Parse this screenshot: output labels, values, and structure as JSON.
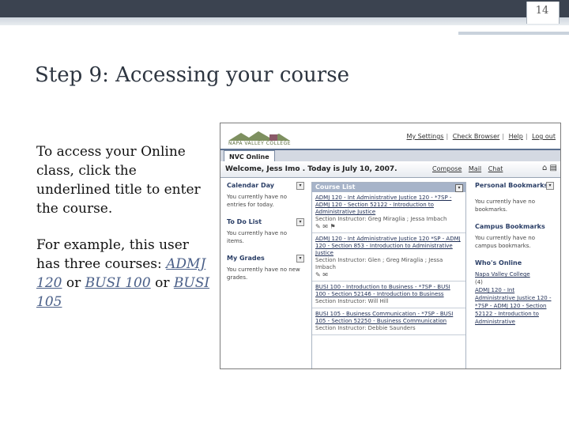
{
  "slide": {
    "number": "14",
    "title": "Step 9: Accessing your course",
    "intro": "To access your Online class, click the underlined title to enter the course.",
    "example_prefix": "For example, this user has three courses:",
    "links": [
      "ADMJ 120",
      "BUSI 100",
      "BUSI 105"
    ],
    "or_word": "or"
  },
  "screenshot": {
    "logo_text": "NAPA VALLEY COLLEGE",
    "top_links": [
      "My Settings",
      "Check Browser",
      "Help",
      "Log out"
    ],
    "tab": "NVC Online",
    "welcome": "Welcome, Jess Imo . Today is July 10, 2007.",
    "welcome_links": [
      "Compose",
      "Mail",
      "Chat"
    ],
    "left": {
      "calendar_head": "Calendar Day",
      "calendar_body": "You currently have no entries for today.",
      "todo_head": "To Do List",
      "todo_body": "You currently have no items.",
      "grades_head": "My Grades",
      "grades_body": "You currently have no new grades."
    },
    "course_list": {
      "head": "Course List",
      "courses": [
        {
          "title": "ADMJ 120 - Int Administrative Justice 120 - *7SP - ADMJ 120 - Section 52122 - Introduction to Administrative Justice",
          "instructor": "Section Instructor: Greg Miraglia ; Jessa Imbach"
        },
        {
          "title": "ADMJ 120 - Int Administrative Justice 120 *SP - ADMJ 120 - Section 853 - Introduction to Administrative Justice",
          "instructor": "Section Instructor: Glen ; Greg Miraglia ; Jessa Imbach"
        },
        {
          "title": "BUSI 100 - Introduction to Business - *7SP - BUSI 100 - Section 52146 - Introduction to Business",
          "instructor": "Section Instructor: Will Hill"
        },
        {
          "title": "BUSI 105 - Business Communication - *7SP - BUSI 105 - Section 52250 - Business Communication",
          "instructor": "Section Instructor: Debbie Saunders"
        }
      ]
    },
    "right": {
      "bookmarks_head": "Personal Bookmarks",
      "bookmarks_body": "You currently have no bookmarks.",
      "campus_head": "Campus Bookmarks",
      "campus_body": "You currently have no campus bookmarks.",
      "online_head": "Who's Online",
      "online_college": "Napa Valley College",
      "online_count": "(4)",
      "online_link": "ADMJ 120 - Int Administrative Justice 120 - *7SP - ADMJ 120 - Section 52122 - Introduction to Administrative"
    }
  }
}
